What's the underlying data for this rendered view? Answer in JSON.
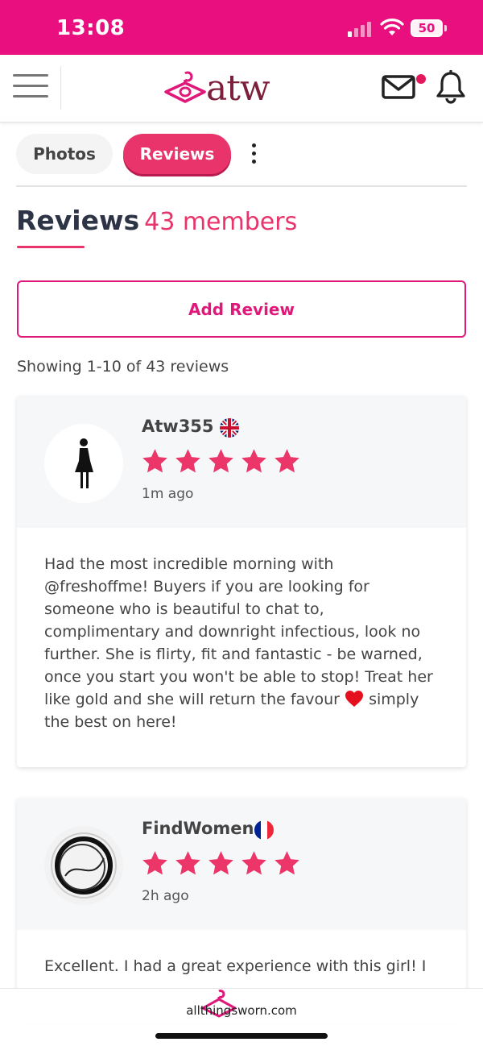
{
  "status_bar": {
    "time": "13:08",
    "battery": "50"
  },
  "header": {
    "logo_text": "atw"
  },
  "tabs": [
    {
      "label": "Photos",
      "active": false
    },
    {
      "label": "Reviews",
      "active": true
    }
  ],
  "reviews_section": {
    "title": "Reviews",
    "count_label": "43 members",
    "add_review_label": "Add Review",
    "showing_text": "Showing 1-10 of 43 reviews"
  },
  "reviews": [
    {
      "username": "Atw355",
      "flag": "uk-flag",
      "rating": 5,
      "time_ago": "1m ago",
      "text_before_emoji": "Had the most incredible morning with @freshoffme! Buyers if you are looking for someone who is beautiful to chat to, complimentary and downright infectious, look no further. She is flirty, fit and fantastic - be warned, once you start you won't be able to stop! Treat her like gold and she will return the favour",
      "text_after_emoji": "simply the best on here!"
    },
    {
      "username": "FindWomen",
      "flag": "france-flag",
      "rating": 5,
      "time_ago": "2h ago",
      "text_before_emoji": "Excellent. I had a great experience with this girl! I",
      "text_after_emoji": ""
    }
  ],
  "bottom_bar": {
    "url": "allthingsworn.com"
  },
  "colors": {
    "brand_pink": "#ea0f7f",
    "accent_pink": "#e8346b",
    "logo_maroon": "#7d1e3a",
    "heading_navy": "#2d3446"
  }
}
